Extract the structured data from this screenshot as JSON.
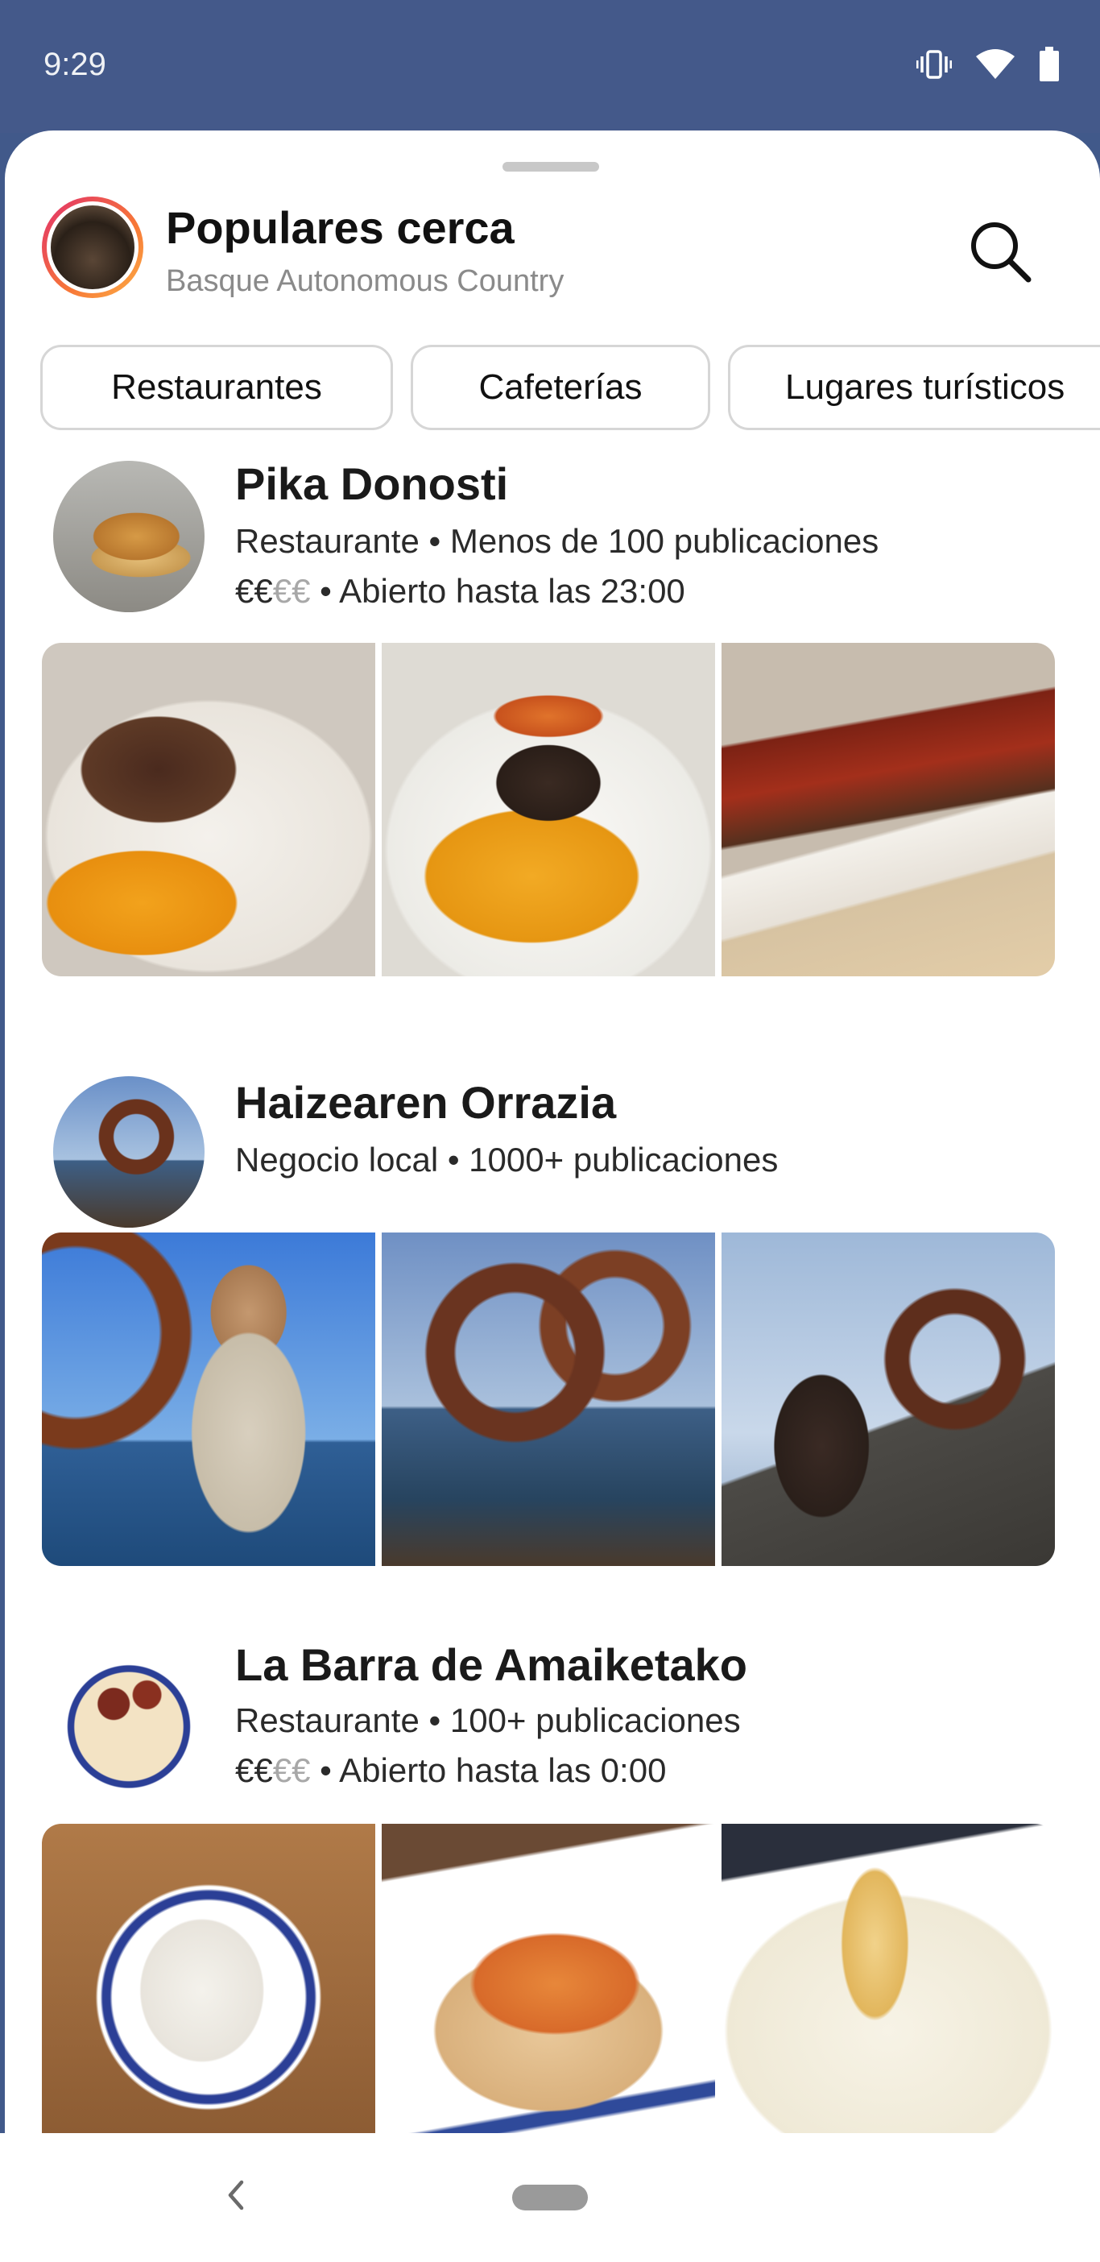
{
  "status_bar": {
    "time": "9:29",
    "icons": [
      "vibrate-icon",
      "wifi-icon",
      "battery-icon"
    ]
  },
  "header": {
    "title": "Populares cerca",
    "subtitle": "Basque Autonomous Country",
    "search_icon": "search-icon"
  },
  "chips": [
    {
      "label": "Restaurantes"
    },
    {
      "label": "Cafeterías"
    },
    {
      "label": "Lugares turísticos"
    }
  ],
  "places": [
    {
      "name": "Pika Donosti",
      "meta": "Restaurante • Menos de 100 publicaciones",
      "price_active": "€€",
      "price_inactive": "€€",
      "hours": " • Abierto hasta las 23:00"
    },
    {
      "name": "Haizearen Orrazia",
      "meta": "Negocio local • 1000+ publicaciones"
    },
    {
      "name": "La Barra de Amaiketako",
      "meta": "Restaurante • 100+ publicaciones",
      "price_active": "€€",
      "price_inactive": "€€",
      "hours": " • Abierto hasta las 0:00"
    }
  ],
  "nav": {
    "back_icon": "back-chevron-icon"
  },
  "colors": {
    "status_bar_bg": "#44598a",
    "sheet_bg": "#ffffff",
    "chip_border": "#d6d6d6",
    "subtitle_gray": "#8a8a8a",
    "price_inactive": "#a8a8a8"
  }
}
